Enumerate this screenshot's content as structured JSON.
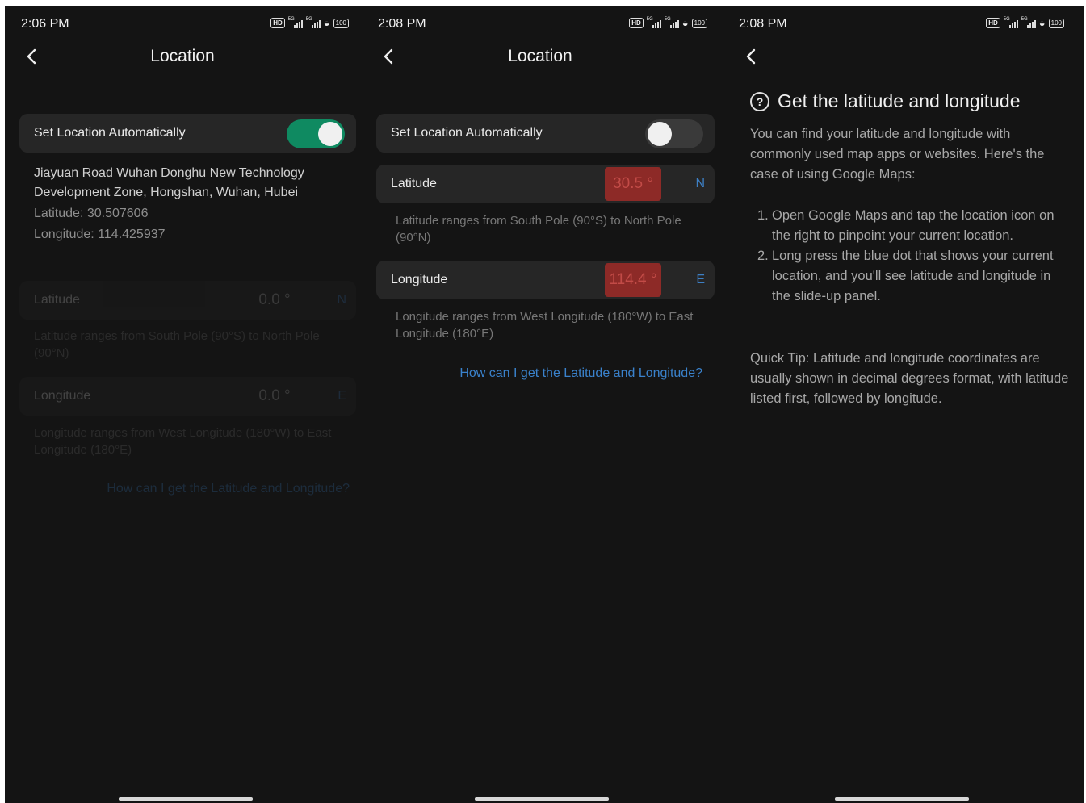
{
  "screens": [
    {
      "status": {
        "time": "2:06 PM",
        "hd": "HD",
        "net1": "5G",
        "net2": "5G",
        "battery": "100"
      },
      "header": {
        "title": "Location"
      },
      "auto_card": {
        "label": "Set Location Automatically",
        "toggle_on": true
      },
      "address": "Jiayuan Road Wuhan Donghu New Technology Development Zone, Hongshan, Wuhan, Hubei",
      "latitude_text": "Latitude: 30.507606",
      "longitude_text": "Longitude: 114.425937",
      "lat_card": {
        "label": "Latitude",
        "value": "0.0 °",
        "dir": "N"
      },
      "lat_hint": "Latitude ranges from South Pole (90°S) to North Pole (90°N)",
      "lon_card": {
        "label": "Longitude",
        "value": "0.0 °",
        "dir": "E"
      },
      "lon_hint": "Longitude ranges from West Longitude (180°W) to East Longitude (180°E)",
      "help_link": "How can I get the Latitude and Longitude?"
    },
    {
      "status": {
        "time": "2:08 PM",
        "hd": "HD",
        "net1": "5G",
        "net2": "5G",
        "battery": "100"
      },
      "header": {
        "title": "Location"
      },
      "auto_card": {
        "label": "Set Location Automatically",
        "toggle_on": false
      },
      "lat_card": {
        "label": "Latitude",
        "value": "30.5 °",
        "dir": "N"
      },
      "lat_hint": "Latitude ranges from South Pole (90°S) to North Pole (90°N)",
      "lon_card": {
        "label": "Longitude",
        "value": "114.4 °",
        "dir": "E"
      },
      "lon_hint": "Longitude ranges from West Longitude (180°W) to East Longitude (180°E)",
      "help_link": "How can I get the Latitude and Longitude?"
    },
    {
      "status": {
        "time": "2:08 PM",
        "hd": "HD",
        "net1": "5G",
        "net2": "5G",
        "battery": "100"
      },
      "help": {
        "title": "Get the latitude and longitude",
        "intro": "You can find your latitude and longitude with commonly used map apps or websites. Here's the case of using Google Maps:",
        "steps": [
          {
            "num": "1.",
            "text": "Open Google Maps and tap the location icon on the right to pinpoint your current location."
          },
          {
            "num": "2.",
            "text": "Long press the blue dot that shows your current location, and you'll see latitude and longitude in the slide-up panel."
          }
        ],
        "tip": "Quick Tip: Latitude and longitude coordinates are usually shown in decimal degrees format, with latitude listed first, followed by longitude."
      }
    }
  ],
  "icons": {
    "back": "chevron-left-icon",
    "help": "question-circle-icon",
    "wifi": "wifi-icon",
    "battery": "battery-icon",
    "signal": "signal-icon"
  },
  "colors": {
    "background": "#141414",
    "card": "#262626",
    "toggle_on": "#0f8a61",
    "error_box": "#8d2a27",
    "link": "#3a82cc"
  }
}
